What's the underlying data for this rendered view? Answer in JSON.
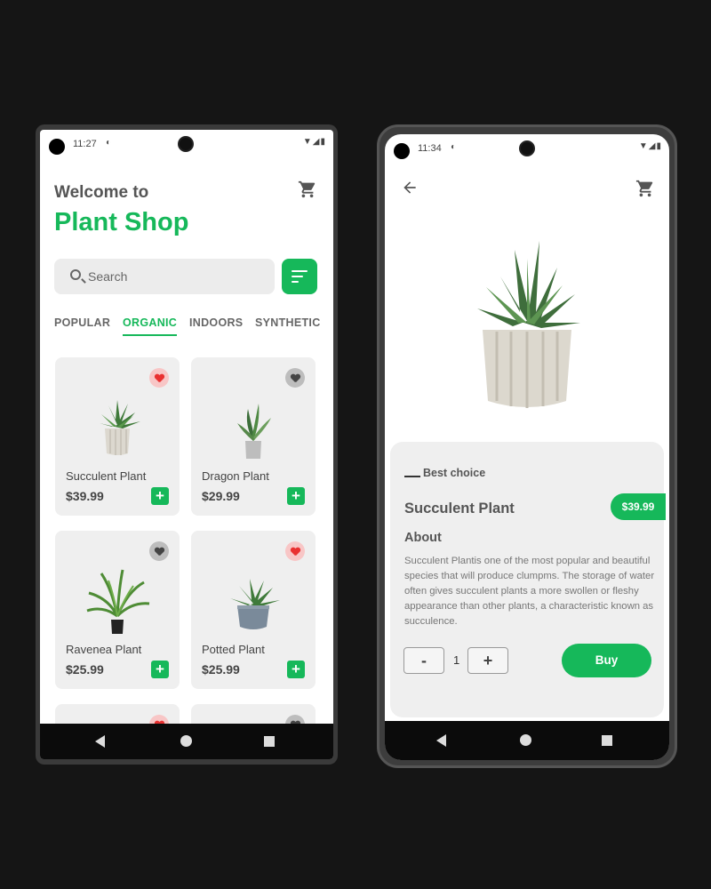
{
  "left": {
    "status": {
      "time": "11:27"
    },
    "header": {
      "welcome": "Welcome to",
      "brand": "Plant Shop"
    },
    "search": {
      "placeholder": "Search"
    },
    "tabs": [
      {
        "label": "POPULAR",
        "active": false
      },
      {
        "label": "ORGANIC",
        "active": true
      },
      {
        "label": "INDOORS",
        "active": false
      },
      {
        "label": "SYNTHETIC",
        "active": false
      }
    ],
    "products": [
      {
        "name": "Succulent Plant",
        "price": "$39.99",
        "favorite": true
      },
      {
        "name": "Dragon Plant",
        "price": "$29.99",
        "favorite": false
      },
      {
        "name": "Ravenea Plant",
        "price": "$25.99",
        "favorite": false
      },
      {
        "name": "Potted Plant",
        "price": "$25.99",
        "favorite": true
      }
    ]
  },
  "right": {
    "status": {
      "time": "11:34"
    },
    "product": {
      "tag": "Best choice",
      "name": "Succulent Plant",
      "price": "$39.99",
      "about_title": "About",
      "description": "Succulent Plantis one of the most popular and beautiful species that will produce clumpms. The storage of water often gives succulent plants a more swollen or fleshy appearance than other plants, a characteristic known as succulence.",
      "quantity": "1",
      "minus_label": "-",
      "plus_label": "+",
      "buy_label": "Buy"
    }
  },
  "colors": {
    "accent": "#16b85a",
    "favorite": "#e93131",
    "background": "#151515"
  },
  "icons": [
    "cart-icon",
    "search-icon",
    "filter-icon",
    "heart-icon",
    "add-icon",
    "back-arrow-icon",
    "nav-back-icon",
    "nav-home-icon",
    "nav-recent-icon"
  ]
}
